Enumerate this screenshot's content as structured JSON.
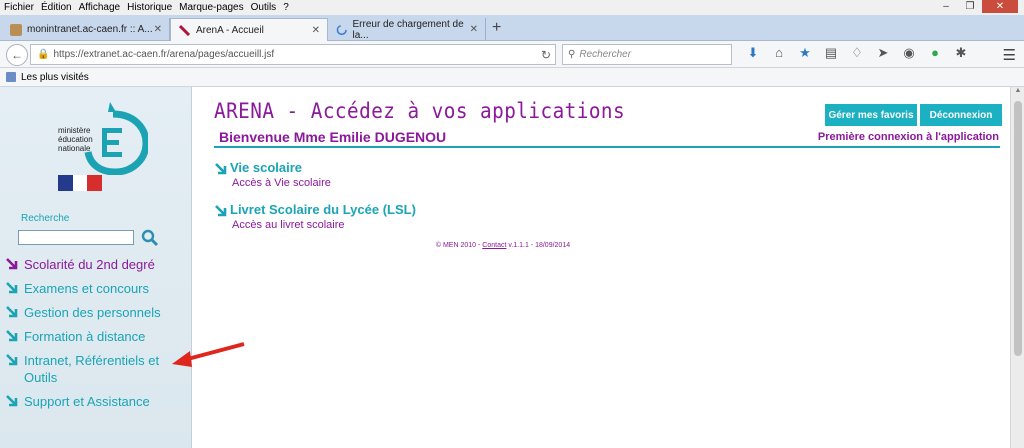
{
  "menubar": {
    "items": [
      "Fichier",
      "Édition",
      "Affichage",
      "Historique",
      "Marque-pages",
      "Outils",
      "?"
    ]
  },
  "tabs": [
    {
      "label": "monintranet.ac-caen.fr :: A...",
      "active": false
    },
    {
      "label": "ArenA - Accueil",
      "active": true
    },
    {
      "label": "Erreur de chargement de la...",
      "active": false
    }
  ],
  "urlbar": {
    "url": "https://extranet.ac-caen.fr/arena/pages/accueill.jsf"
  },
  "searchbar": {
    "placeholder": "Rechercher"
  },
  "bookmarks": {
    "most_visited": "Les plus visités"
  },
  "sidebar": {
    "logo_text": [
      "ministère",
      "éducation",
      "nationale"
    ],
    "search_label": "Recherche",
    "items": [
      {
        "label": "Scolarité du 2nd degré",
        "color": "#8b1a9a"
      },
      {
        "label": "Examens et concours",
        "color": "#1aa4b4"
      },
      {
        "label": "Gestion des personnels",
        "color": "#1aa4b4"
      },
      {
        "label": "Formation à distance",
        "color": "#1aa4b4"
      },
      {
        "label": "Intranet, Référentiels et Outils",
        "color": "#1aa4b4"
      },
      {
        "label": "Support et Assistance",
        "color": "#1aa4b4"
      }
    ]
  },
  "main": {
    "title": "ARENA - Accédez à vos applications",
    "btn_favorites": "Gérer mes favoris",
    "btn_logout": "Déconnexion",
    "welcome": "Bienvenue Mme Emilie DUGENOU",
    "first_connection": "Première connexion à l'application",
    "apps": [
      {
        "title": "Vie scolaire",
        "desc": "Accès à Vie scolaire"
      },
      {
        "title": "Livret Scolaire du Lycée (LSL)",
        "desc": "Accès au livret scolaire"
      }
    ],
    "footer": {
      "prefix": "© MEN 2010 - ",
      "contact": "Contact",
      "suffix": " v.1.1.1 - 18/09/2014"
    }
  },
  "colors": {
    "accent": "#1aa4b4",
    "brand": "#8b1a9a",
    "annotation": "#e0261c"
  }
}
